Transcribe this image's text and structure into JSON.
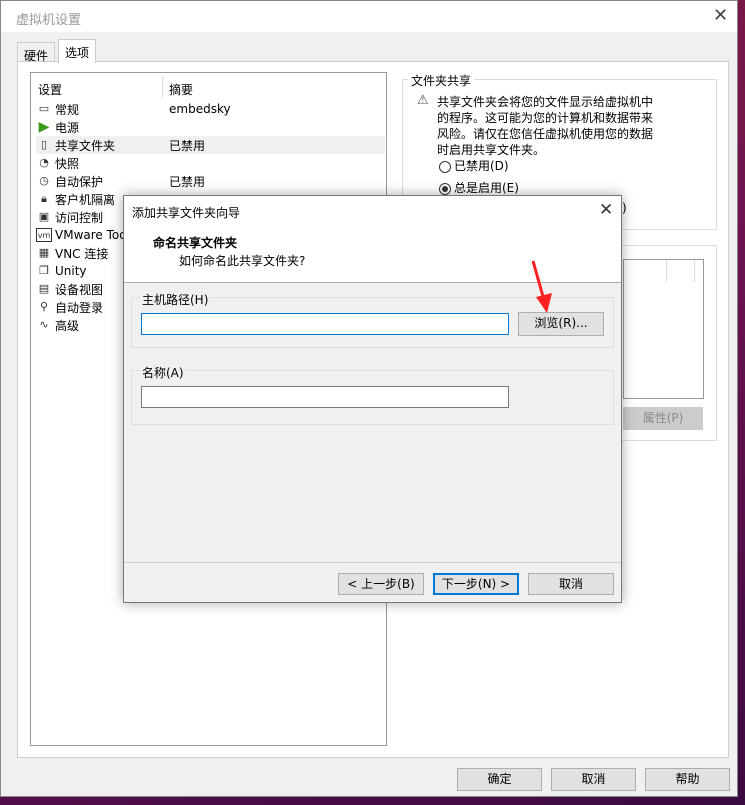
{
  "window": {
    "title": "虚拟机设置",
    "close": "✕"
  },
  "tabs": [
    {
      "label": "硬件"
    },
    {
      "label": "选项"
    }
  ],
  "list": {
    "col_setting": "设置",
    "col_summary": "摘要",
    "items": [
      {
        "label": "常规",
        "summary": "embedsky",
        "icon": "monitor-icon"
      },
      {
        "label": "电源",
        "summary": "",
        "icon": "play-icon"
      },
      {
        "label": "共享文件夹",
        "summary": "已禁用",
        "icon": "folder-icon"
      },
      {
        "label": "快照",
        "summary": "",
        "icon": "snapshot-icon"
      },
      {
        "label": "自动保护",
        "summary": "已禁用",
        "icon": "clock-icon"
      },
      {
        "label": "客户机隔离",
        "summary": "",
        "icon": "lock-icon"
      },
      {
        "label": "访问控制",
        "summary": "",
        "icon": "access-control-icon"
      },
      {
        "label": "VMware Tools",
        "summary": "",
        "icon": "vm-icon"
      },
      {
        "label": "VNC 连接",
        "summary": "",
        "icon": "vnc-icon"
      },
      {
        "label": "Unity",
        "summary": "",
        "icon": "unity-icon"
      },
      {
        "label": "设备视图",
        "summary": "",
        "icon": "device-view-icon"
      },
      {
        "label": "自动登录",
        "summary": "",
        "icon": "user-key-icon"
      },
      {
        "label": "高级",
        "summary": "",
        "icon": "advanced-icon"
      }
    ]
  },
  "sharing": {
    "group": "文件夹共享",
    "warning": "共享文件夹会将您的文件显示给虚拟机中的程序。这可能为您的计算机和数据带来风险。请仅在您信任虚拟机使用您的数据时启用共享文件夹。",
    "opt_disabled": "已禁用(D)",
    "opt_always": "总是启用(E)",
    "opt_third_partial": ")",
    "selected": "always",
    "properties": "属性(P)"
  },
  "footer": {
    "ok": "确定",
    "cancel": "取消",
    "help": "帮助"
  },
  "dialog": {
    "title": "添加共享文件夹向导",
    "close": "✕",
    "heading": "命名共享文件夹",
    "subheading": "如何命名此共享文件夹?",
    "host_path_label": "主机路径(H)",
    "host_path_value": "",
    "browse": "浏览(R)...",
    "name_label": "名称(A)",
    "name_value": "",
    "back": "< 上一步(B)",
    "next": "下一步(N) >",
    "cancel": "取消"
  },
  "colors": {
    "annotation_arrow": "#ff2020",
    "focus": "#0078d7"
  }
}
